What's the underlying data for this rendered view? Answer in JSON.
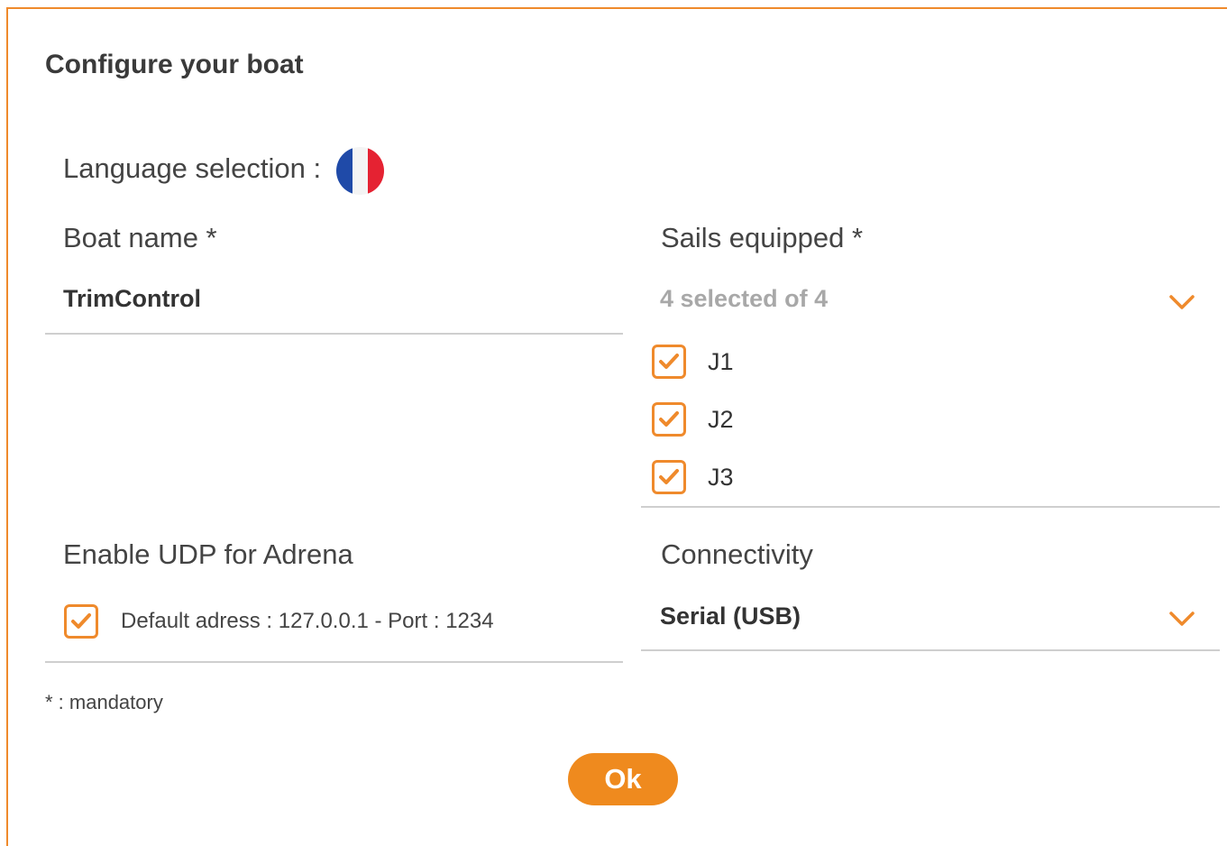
{
  "dialog": {
    "title": "Configure your boat",
    "language": {
      "label": "Language selection :",
      "flag_icon": "france-flag-icon"
    },
    "boat_name": {
      "label": "Boat name *",
      "value": "TrimControl"
    },
    "sails": {
      "label": "Sails equipped *",
      "summary": "4 selected of 4",
      "items": [
        {
          "label": "J1",
          "checked": true
        },
        {
          "label": "J2",
          "checked": true
        },
        {
          "label": "J3",
          "checked": true
        }
      ]
    },
    "udp": {
      "label": "Enable UDP for Adrena",
      "checked": true,
      "description": "Default adress : 127.0.0.1 - Port : 1234"
    },
    "connectivity": {
      "label": "Connectivity",
      "value": "Serial (USB)"
    },
    "mandatory_note": "* : mandatory",
    "ok_label": "Ok"
  },
  "colors": {
    "accent": "#ef8a2c",
    "text": "#333333",
    "muted": "#a8a8a8",
    "divider": "#cfcfcf"
  }
}
